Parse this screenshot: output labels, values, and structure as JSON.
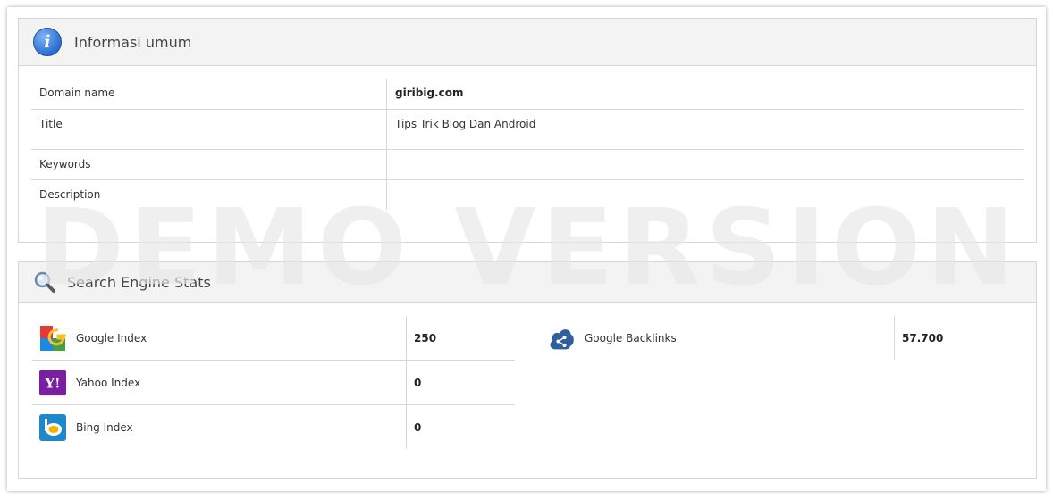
{
  "watermark": "DEMO VERSION",
  "general_info": {
    "title": "Informasi umum",
    "rows": [
      {
        "label": "Domain name",
        "value": "giribig.com"
      },
      {
        "label": "Title",
        "value": "Tips Trik Blog Dan Android"
      },
      {
        "label": "Keywords",
        "value": ""
      },
      {
        "label": "Description",
        "value": ""
      }
    ]
  },
  "search_stats": {
    "title": "Search Engine Stats",
    "left": [
      {
        "name": "Google Index",
        "value": "250",
        "icon": "google-icon"
      },
      {
        "name": "Yahoo Index",
        "value": "0",
        "icon": "yahoo-icon"
      },
      {
        "name": "Bing Index",
        "value": "0",
        "icon": "bing-icon"
      }
    ],
    "right": [
      {
        "name": "Google Backlinks",
        "value": "57.700",
        "icon": "share-icon"
      }
    ]
  },
  "colors": {
    "header_bg": "#f3f3f3",
    "border": "#d6d6d6",
    "info_blue": "#2a6fd4",
    "yahoo_purple": "#7b1fa2",
    "bing_blue": "#1e88c8",
    "backlinks_blue": "#2f5f9e"
  }
}
